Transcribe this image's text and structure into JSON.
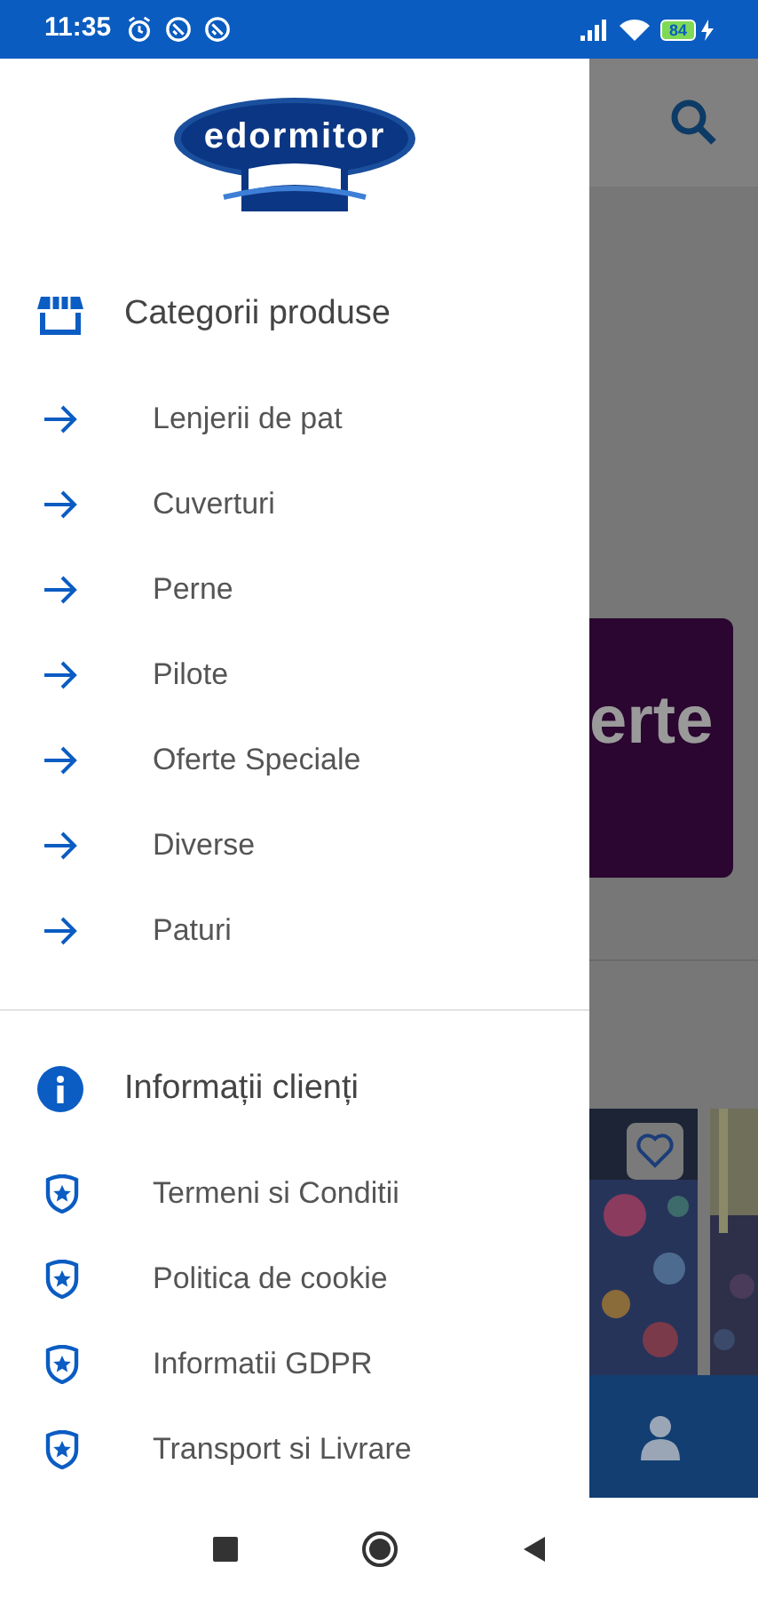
{
  "status_bar": {
    "time": "11:35",
    "battery": "84"
  },
  "drawer": {
    "logo": "edormitor",
    "sections": [
      {
        "kind": "categories",
        "title": "Categorii produse",
        "items": [
          {
            "label": "Lenjerii de pat"
          },
          {
            "label": "Cuverturi"
          },
          {
            "label": "Perne"
          },
          {
            "label": "Pilote"
          },
          {
            "label": "Oferte Speciale"
          },
          {
            "label": "Diverse"
          },
          {
            "label": "Paturi"
          }
        ]
      },
      {
        "kind": "info",
        "title": "Informații clienți",
        "items": [
          {
            "label": "Termeni si Conditii"
          },
          {
            "label": "Politica de cookie"
          },
          {
            "label": "Informatii GDPR"
          },
          {
            "label": "Transport si Livrare"
          }
        ]
      }
    ]
  },
  "background": {
    "banner_text": "erte"
  }
}
